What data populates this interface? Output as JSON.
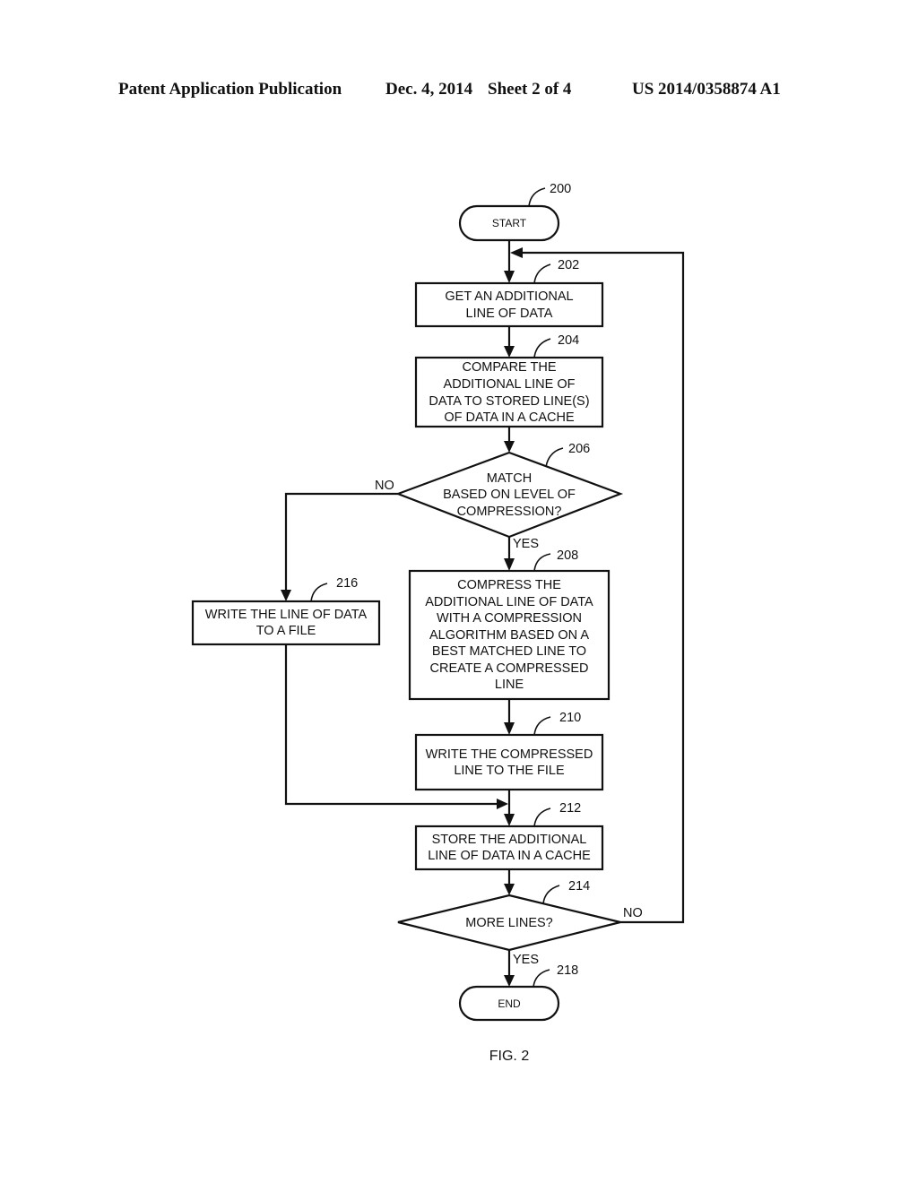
{
  "header": {
    "publication": "Patent Application Publication",
    "date": "Dec. 4, 2014",
    "sheet": "Sheet 2 of 4",
    "number": "US 2014/0358874 A1"
  },
  "figure": {
    "caption": "FIG. 2",
    "flow_ref": "200",
    "nodes": [
      {
        "id": "start",
        "ref": "",
        "type": "terminal",
        "lines": [
          "START"
        ]
      },
      {
        "id": "202",
        "ref": "202",
        "type": "process",
        "lines": [
          "GET AN ADDITIONAL",
          "LINE OF DATA"
        ]
      },
      {
        "id": "204",
        "ref": "204",
        "type": "process",
        "lines": [
          "COMPARE THE",
          "ADDITIONAL LINE OF",
          "DATA TO STORED LINE(S)",
          "OF DATA IN A CACHE"
        ]
      },
      {
        "id": "206",
        "ref": "206",
        "type": "decision",
        "lines": [
          "MATCH",
          "BASED ON LEVEL OF",
          "COMPRESSION?"
        ]
      },
      {
        "id": "208",
        "ref": "208",
        "type": "process",
        "lines": [
          "COMPRESS THE",
          "ADDITIONAL LINE OF DATA",
          "WITH A COMPRESSION",
          "ALGORITHM BASED ON A",
          "BEST MATCHED LINE TO",
          "CREATE A COMPRESSED",
          "LINE"
        ]
      },
      {
        "id": "216",
        "ref": "216",
        "type": "process",
        "lines": [
          "WRITE THE LINE OF DATA",
          "TO A FILE"
        ]
      },
      {
        "id": "210",
        "ref": "210",
        "type": "process",
        "lines": [
          "WRITE THE COMPRESSED",
          "LINE TO THE FILE"
        ]
      },
      {
        "id": "212",
        "ref": "212",
        "type": "process",
        "lines": [
          "STORE THE ADDITIONAL",
          "LINE OF DATA IN A CACHE"
        ]
      },
      {
        "id": "214",
        "ref": "214",
        "type": "decision",
        "lines": [
          "MORE LINES?"
        ]
      },
      {
        "id": "end",
        "ref": "218",
        "type": "terminal",
        "lines": [
          "END"
        ]
      }
    ],
    "edges": [
      {
        "from": "start",
        "to": "202",
        "label": ""
      },
      {
        "from": "202",
        "to": "204",
        "label": ""
      },
      {
        "from": "204",
        "to": "206",
        "label": ""
      },
      {
        "from": "206",
        "to": "208",
        "label": "YES"
      },
      {
        "from": "206",
        "to": "216",
        "label": "NO"
      },
      {
        "from": "208",
        "to": "210",
        "label": ""
      },
      {
        "from": "210",
        "to": "212",
        "label": ""
      },
      {
        "from": "216",
        "to": "212",
        "label": ""
      },
      {
        "from": "212",
        "to": "214",
        "label": ""
      },
      {
        "from": "214",
        "to": "end",
        "label": "YES"
      },
      {
        "from": "214",
        "to": "202",
        "label": "NO"
      }
    ]
  }
}
